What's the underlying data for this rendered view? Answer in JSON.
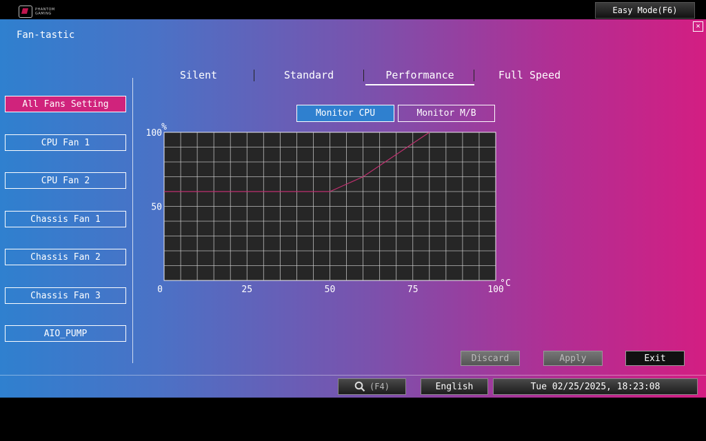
{
  "topbar": {
    "brand_line1": "PHANTOM",
    "brand_line2": "GAMING",
    "easy_mode_label": "Easy Mode(F6)"
  },
  "window": {
    "title": "Fan-tastic",
    "close_glyph": "×"
  },
  "sidebar": {
    "items": [
      {
        "label": "All Fans Setting",
        "active": true
      },
      {
        "label": "CPU Fan 1"
      },
      {
        "label": "CPU Fan 2"
      },
      {
        "label": "Chassis Fan 1"
      },
      {
        "label": "Chassis Fan 2"
      },
      {
        "label": "Chassis Fan 3"
      },
      {
        "label": "AIO_PUMP"
      }
    ]
  },
  "tabs": [
    {
      "label": "Silent"
    },
    {
      "label": "Standard"
    },
    {
      "label": "Performance",
      "active": true
    },
    {
      "label": "Full Speed"
    }
  ],
  "monitor": {
    "cpu_label": "Monitor CPU",
    "mb_label": "Monitor M/B",
    "selected": "Monitor CPU"
  },
  "chart_data": {
    "type": "line",
    "ylabel": "%",
    "xlabel": "°C",
    "xlim": [
      0,
      100
    ],
    "ylim": [
      0,
      100
    ],
    "x_ticks": [
      0,
      25,
      50,
      75,
      100
    ],
    "y_ticks": [
      50,
      100
    ],
    "y_tick_labels": [
      "50",
      "100"
    ],
    "x_tick_labels": [
      "25",
      "50",
      "75",
      "100"
    ],
    "origin_label": "0",
    "grid": true,
    "series": [
      {
        "x": [
          0,
          50,
          60,
          80
        ],
        "values": [
          60,
          60,
          70,
          100
        ]
      }
    ],
    "colors": {
      "plot_bg": "#262626",
      "grid": "#d8d8d8",
      "line": "#c0306f"
    }
  },
  "actions": {
    "discard": "Discard",
    "apply": "Apply",
    "exit": "Exit"
  },
  "statusbar": {
    "search_hint": "(F4)",
    "language": "English",
    "datetime": "Tue 02/25/2025, 18:23:08"
  },
  "colors": {
    "active_sidebar": "#d0237c",
    "active_monitor": "#2f80cf"
  }
}
